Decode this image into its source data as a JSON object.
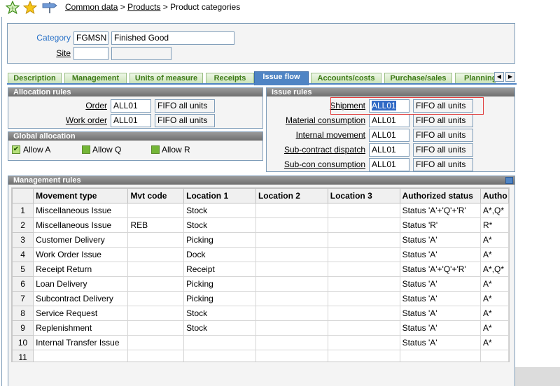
{
  "breadcrumb": {
    "items": [
      "Common data",
      "Products"
    ],
    "separator": ">",
    "current": "Product categories"
  },
  "header": {
    "category_label": "Category",
    "category_code": "FGMSN",
    "category_desc": "Finished Good",
    "site_label": "Site",
    "site_code": "",
    "site_desc": ""
  },
  "tabs": [
    {
      "label": "Description",
      "active": false
    },
    {
      "label": "Management",
      "active": false
    },
    {
      "label": "Units of measure",
      "active": false
    },
    {
      "label": "Receipts",
      "active": false
    },
    {
      "label": "Issue flow",
      "active": true
    },
    {
      "label": "Accounts/costs",
      "active": false
    },
    {
      "label": "Purchase/sales",
      "active": false
    },
    {
      "label": "Planning",
      "active": false
    }
  ],
  "allocation_rules": {
    "title": "Allocation rules",
    "rows": [
      {
        "label": "Order",
        "code": "ALL01",
        "desc": "FIFO all units"
      },
      {
        "label": "Work order",
        "code": "ALL01",
        "desc": "FIFO all units"
      }
    ]
  },
  "global_allocation": {
    "title": "Global allocation",
    "items": [
      {
        "label": "Allow A",
        "checked": true
      },
      {
        "label": "Allow Q",
        "checked": false
      },
      {
        "label": "Allow R",
        "checked": false
      }
    ]
  },
  "issue_rules": {
    "title": "Issue rules",
    "rows": [
      {
        "label": "Shipment",
        "code": "ALL01",
        "desc": "FIFO all units"
      },
      {
        "label": "Material consumption",
        "code": "ALL01",
        "desc": "FIFO all units"
      },
      {
        "label": "Internal movement",
        "code": "ALL01",
        "desc": "FIFO all units"
      },
      {
        "label": "Sub-contract dispatch",
        "code": "ALL01",
        "desc": "FIFO all units"
      },
      {
        "label": "Sub-con consumption",
        "code": "ALL01",
        "desc": "FIFO all units"
      }
    ]
  },
  "management_rules": {
    "title": "Management rules",
    "columns": [
      "",
      "Movement type",
      "Mvt code",
      "Location 1",
      "Location 2",
      "Location 3",
      "Authorized status",
      "Autho"
    ],
    "rows": [
      [
        "1",
        "Miscellaneous Issue",
        "",
        "Stock",
        "",
        "",
        "Status 'A'+'Q'+'R'",
        "A*,Q*"
      ],
      [
        "2",
        "Miscellaneous Issue",
        "REB",
        "Stock",
        "",
        "",
        "Status 'R'",
        "R*"
      ],
      [
        "3",
        "Customer Delivery",
        "",
        "Picking",
        "",
        "",
        "Status 'A'",
        "A*"
      ],
      [
        "4",
        "Work Order Issue",
        "",
        "Dock",
        "",
        "",
        "Status 'A'",
        "A*"
      ],
      [
        "5",
        "Receipt Return",
        "",
        "Receipt",
        "",
        "",
        "Status 'A'+'Q'+'R'",
        "A*,Q*"
      ],
      [
        "6",
        "Loan Delivery",
        "",
        "Picking",
        "",
        "",
        "Status 'A'",
        "A*"
      ],
      [
        "7",
        "Subcontract Delivery",
        "",
        "Picking",
        "",
        "",
        "Status 'A'",
        "A*"
      ],
      [
        "8",
        "Service Request",
        "",
        "Stock",
        "",
        "",
        "Status 'A'",
        "A*"
      ],
      [
        "9",
        "Replenishment",
        "",
        "Stock",
        "",
        "",
        "Status 'A'",
        "A*"
      ],
      [
        "10",
        "Internal Transfer Issue",
        "",
        "",
        "",
        "",
        "Status 'A'",
        "A*"
      ],
      [
        "11",
        "",
        "",
        "",
        "",
        "",
        "",
        ""
      ]
    ]
  }
}
